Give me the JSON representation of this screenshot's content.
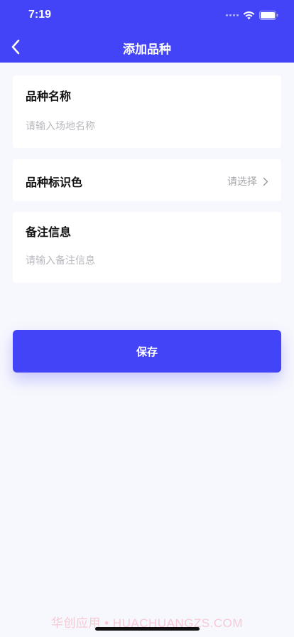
{
  "status_bar": {
    "time": "7:19"
  },
  "header": {
    "title": "添加品种"
  },
  "form": {
    "name_label": "品种名称",
    "name_placeholder": "请输入场地名称",
    "color_label": "品种标识色",
    "color_select": "请选择",
    "notes_label": "备注信息",
    "notes_placeholder": "请输入备注信息"
  },
  "save_label": "保存",
  "watermark": "华创应用 • HUACHUANGZS.COM",
  "colors": {
    "primary": "#4343f7",
    "background": "#f7f8fd",
    "placeholder": "#b9b9bf"
  },
  "icons": [
    "back-chevron-icon",
    "wifi-icon",
    "battery-icon",
    "chevron-right-icon"
  ]
}
